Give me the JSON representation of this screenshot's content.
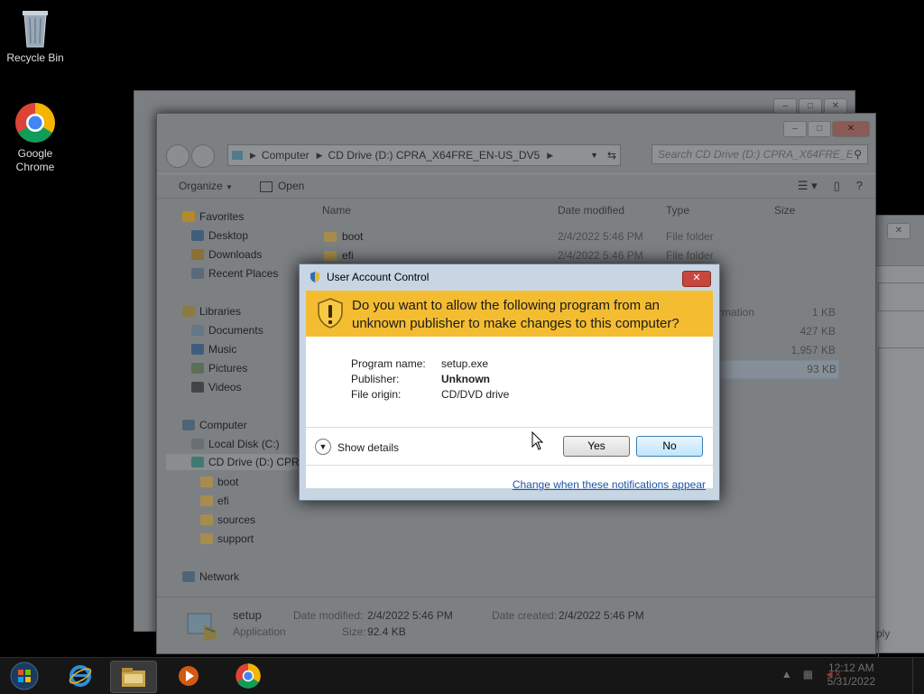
{
  "desktop": {
    "icons": [
      {
        "label_line1": "Recycle Bin",
        "label_line2": ""
      },
      {
        "label_line1": "Google",
        "label_line2": "Chrome"
      }
    ]
  },
  "explorer": {
    "address_segments": [
      "Computer",
      "CD Drive (D:) CPRA_X64FRE_EN-US_DV5"
    ],
    "search_placeholder": "Search CD Drive (D:) CPRA_X64FRE_E...",
    "toolbar": {
      "organize": "Organize",
      "open": "Open"
    },
    "nav": {
      "favorites": "Favorites",
      "desktop": "Desktop",
      "downloads": "Downloads",
      "recent": "Recent Places",
      "libraries": "Libraries",
      "documents": "Documents",
      "music": "Music",
      "pictures": "Pictures",
      "videos": "Videos",
      "computer": "Computer",
      "local_disk": "Local Disk (C:)",
      "cd_drive": "CD Drive (D:) CPRA",
      "boot": "boot",
      "efi": "efi",
      "sources": "sources",
      "support": "support",
      "network": "Network"
    },
    "columns": {
      "name": "Name",
      "date": "Date modified",
      "type": "Type",
      "size": "Size"
    },
    "rows": [
      {
        "name": "boot",
        "date": "2/4/2022 5:46 PM",
        "type": "File folder",
        "size": ""
      },
      {
        "name": "efi",
        "date": "2/4/2022 5:46 PM",
        "type": "File folder",
        "size": ""
      }
    ],
    "partial_rows": [
      {
        "type": "rmation",
        "size": "1 KB"
      },
      {
        "type": "",
        "size": "427 KB"
      },
      {
        "type": "",
        "size": "1,957 KB"
      },
      {
        "type": "",
        "size": "93 KB"
      }
    ],
    "status": {
      "name": "setup",
      "kind": "Application",
      "date_modified_label": "Date modified:",
      "date_modified": "2/4/2022 5:46 PM",
      "size_label": "Size:",
      "size": "92.4 KB",
      "date_created_label": "Date created:",
      "date_created": "2/4/2022 5:46 PM"
    },
    "back_window_partial": "ply"
  },
  "uac": {
    "title": "User Account Control",
    "question": "Do you want to allow the following program from an unknown publisher to make changes to this computer?",
    "program_name_label": "Program name:",
    "program_name": "setup.exe",
    "publisher_label": "Publisher:",
    "publisher": "Unknown",
    "file_origin_label": "File origin:",
    "file_origin": "CD/DVD drive",
    "show_details": "Show details",
    "yes": "Yes",
    "no": "No",
    "change_link": "Change when these notifications appear",
    "accent": "#f4bd31"
  },
  "taskbar": {
    "time": "12:12 AM",
    "date": "5/31/2022",
    "icons": [
      "start-orb-icon",
      "internet-explorer-icon",
      "file-explorer-icon",
      "media-player-icon",
      "chrome-icon"
    ]
  }
}
